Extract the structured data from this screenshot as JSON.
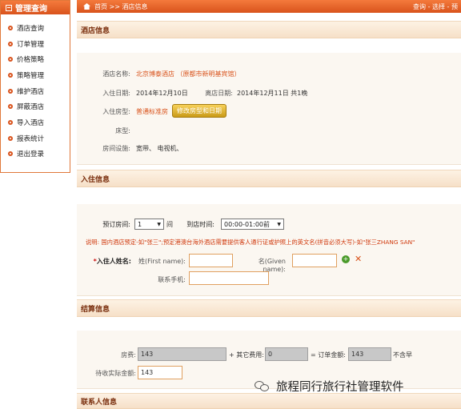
{
  "sidebar": {
    "title": "管理查询",
    "items": [
      {
        "label": "酒店查询"
      },
      {
        "label": "订单管理"
      },
      {
        "label": "价格策略"
      },
      {
        "label": "策略管理"
      },
      {
        "label": "维护酒店"
      },
      {
        "label": "屏蔽酒店"
      },
      {
        "label": "导入酒店"
      },
      {
        "label": "报表统计"
      },
      {
        "label": "退出登录"
      }
    ]
  },
  "topbar": {
    "breadcrumb": "首页  >>  酒店信息",
    "right_links": "查询 - 选择 - 预"
  },
  "hotel_section": {
    "title": "酒店信息",
    "name_label": "酒店名称:",
    "name_value": "北京博泰酒店 （原都市新明基宾馆）",
    "checkin_label": "入住日期:",
    "checkin_value": "2014年12月10日",
    "checkout_label": "离店日期:",
    "checkout_value": "2014年12月11日 共1晚",
    "roomtype_label": "入住房型:",
    "roomtype_value": "普通标准房",
    "modify_button": "修改房型和日期",
    "bedtype_label": "床型:",
    "bedtype_value": "",
    "facility_label": "房间设施:",
    "facility_value": "宽带、 电视机、"
  },
  "checkin_section": {
    "title": "入住信息",
    "rooms_label": "预订房间:",
    "rooms_value": "1",
    "rooms_unit": "间",
    "arrival_label": "到店时间:",
    "arrival_value": "00:00-01:00前",
    "note": "说明: 国内酒店预定-如\"张三\";预定港澳台海外酒店需要提供客人通行证或护照上的英文名(拼音必须大写)-如\"张三ZHANG SAN\"",
    "guest_label_star": "*",
    "guest_label": "入住人姓名:",
    "first_name_label": "姓(First name):",
    "first_name_value": "",
    "given_name_label": "名(Given name):",
    "given_name_value": "",
    "phone_label": "联系手机:",
    "phone_value": ""
  },
  "settle_section": {
    "title": "结算信息",
    "room_fee_label": "房费:",
    "room_fee_value": "143",
    "other_fee_label": "+ 其它费用:",
    "other_fee_value": "0",
    "order_total_label": "= 订单金额:",
    "order_total_value": "143",
    "order_note": "不含早",
    "actual_label": "待收实际金额:",
    "actual_value": "143"
  },
  "contact_section": {
    "title": "联系人信息"
  },
  "watermark": {
    "text": "旅程同行旅行社管理软件"
  },
  "colors": {
    "accent": "#d9531c",
    "header_gradient_top": "#f47a3c",
    "section_bg": "#fbf7f1",
    "note_red": "#d03a0e",
    "button_gold": "#e0b030"
  }
}
